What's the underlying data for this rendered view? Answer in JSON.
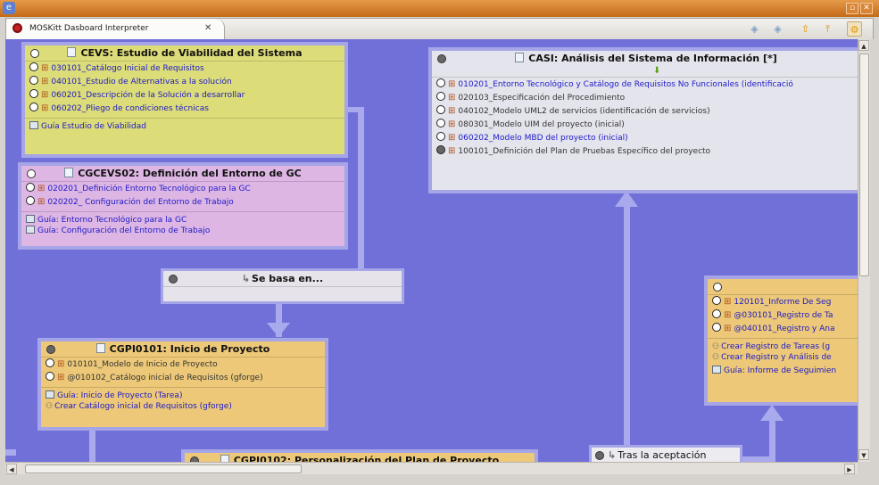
{
  "window": {
    "minimize_glyph": "▫",
    "close_glyph": "✕"
  },
  "tab": {
    "title": "MOSKitt Dasboard Interpreter",
    "close_glyph": "✕"
  },
  "toolbar": {
    "icons": [
      "tag-icon",
      "tag-multi-icon",
      "arrow-up-icon",
      "arrow-top-icon",
      "settings-icon"
    ]
  },
  "boxes": {
    "cevs": {
      "title": "CEVS: Estudio de Viabilidad del Sistema",
      "color": "#dcdc78",
      "items": [
        "030101_Catálogo Inicial de Requisitos",
        "040101_Estudio de Alternativas a la solución",
        "060201_Descripción de la Solución a desarrollar",
        "060202_Pliego de condiciones técnicas"
      ],
      "guides": [
        "Guía Estudio de Viabilidad"
      ]
    },
    "cgcevs02": {
      "title": "CGCEVS02: Definición del Entorno de GC",
      "color": "#ddb6e4",
      "items": [
        "020201_Definición Entorno Tecnológico para la GC",
        "020202_ Configuración del Entorno de Trabajo"
      ],
      "guides": [
        "Guía: Entorno Tecnológico para la GC",
        "Guía: Configuración del Entorno de Trabajo"
      ]
    },
    "casi": {
      "title": "CASI: Análisis del Sistema de Información [*]",
      "color": "#e4e4ec",
      "items": [
        {
          "text": "010201_Entorno Tecnológico y Catálogo de Requisitos No Funcionales (identificació",
          "link": true
        },
        {
          "text": "020103_Especificación del Procedimiento",
          "link": false
        },
        {
          "text": "040102_Modelo UML2 de servicios (identificación de servicios)",
          "link": false
        },
        {
          "text": "080301_Modelo UIM del proyecto (inicial)",
          "link": false
        },
        {
          "text": "060202_Modelo MBD del proyecto (inicial)",
          "link": true
        },
        {
          "text": "100101_Definición del Plan de Pruebas Específico del proyecto",
          "link": false
        }
      ]
    },
    "sebasa": {
      "title": "Se basa en..."
    },
    "cgpi0101": {
      "title": "CGPI0101: Inicio de Proyecto",
      "color": "#ecc878",
      "items": [
        {
          "text": "010101_Modelo de Inicio de Proyecto",
          "link": false
        },
        {
          "text": "@010102_Catálogo inicial de Requisitos (gforge)",
          "link": false
        }
      ],
      "guides": [
        "Guía: Inicio de Proyecto (Tarea)"
      ],
      "actions": [
        "Crear Catálogo inicial de Requisitos (gforge)"
      ]
    },
    "right": {
      "color": "#ecc878",
      "items": [
        "120101_Informe De Seg",
        "@030101_Registro de Ta",
        "@040101_Registro y Ana"
      ],
      "actions": [
        "Crear Registro de Tareas (g",
        "Crear Registro y Análisis de"
      ],
      "guides": [
        "Guía: Informe de Seguimien"
      ]
    },
    "cgpi0102": {
      "title": "CGPI0102: Personalización del Plan de Proyecto"
    },
    "tras": {
      "title": "Tras la aceptación"
    }
  }
}
